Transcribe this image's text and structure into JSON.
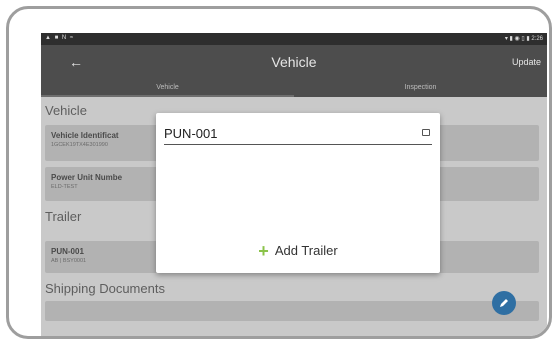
{
  "status_bar": {
    "left": "▲ ■ N ≈",
    "right": "▾ ▮ ◉ ▯ ▮ 2:26"
  },
  "app_bar": {
    "back": "←",
    "title": "Vehicle",
    "action": "Update"
  },
  "tabs": [
    {
      "label": "Vehicle",
      "active": true
    },
    {
      "label": "Inspection",
      "active": false
    }
  ],
  "content": {
    "vehicle_section": "Vehicle",
    "vin_card": {
      "title": "Vehicle Identificat",
      "subtitle": "1GCEK19TX4E301990"
    },
    "power_unit_card": {
      "title": "Power Unit Numbe",
      "subtitle": "ELD-TEST"
    },
    "trailer_section": "Trailer",
    "trailer_card": {
      "title": "PUN-001",
      "subtitle": "AB | BSY0001"
    },
    "shipping_section": "Shipping Documents"
  },
  "dialog": {
    "field_value": "PUN-001",
    "add_label": "Add Trailer",
    "add_icon": "plus-icon",
    "accent": "#8bc34a"
  },
  "fab": {
    "icon": "pencil-icon",
    "color": "#2f6fa3"
  }
}
